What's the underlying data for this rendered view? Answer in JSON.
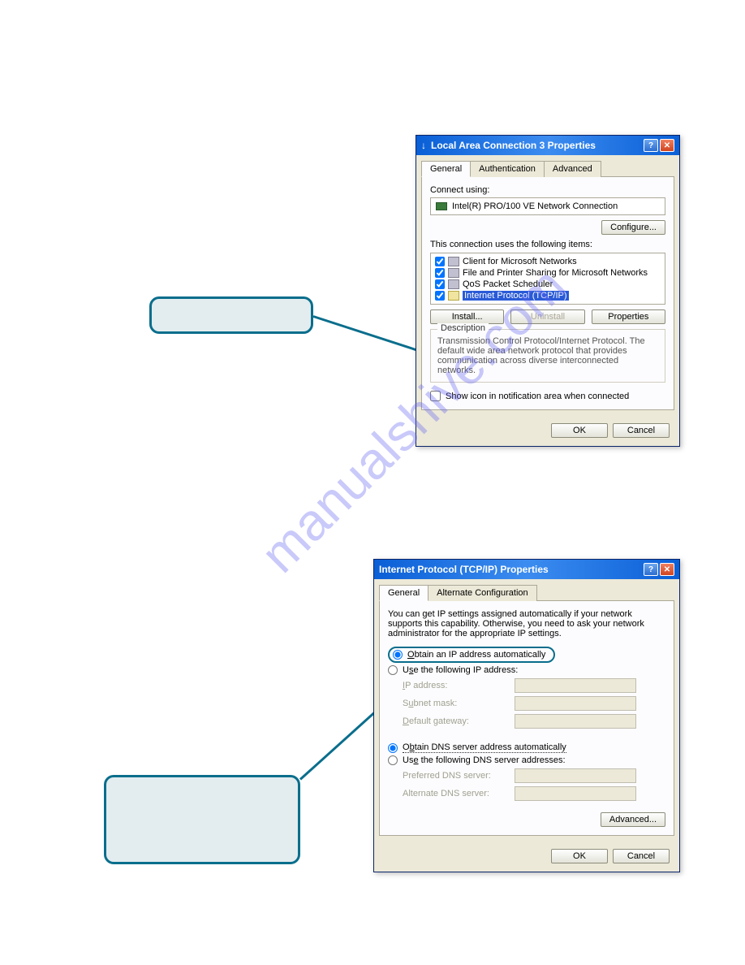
{
  "watermark": "manualshive.com",
  "dialog1": {
    "title": "Local Area Connection 3 Properties",
    "tabs": {
      "general": "General",
      "auth": "Authentication",
      "advanced": "Advanced"
    },
    "connect_using_label": "Connect using:",
    "adapter_name": "Intel(R) PRO/100 VE Network Connection",
    "configure_btn": "Configure...",
    "items_label": "This connection uses the following items:",
    "items": [
      "Client for Microsoft Networks",
      "File and Printer Sharing for Microsoft Networks",
      "QoS Packet Scheduler",
      "Internet Protocol (TCP/IP)"
    ],
    "install_btn": "Install...",
    "uninstall_btn": "Uninstall",
    "properties_btn": "Properties",
    "description_legend": "Description",
    "description_text": "Transmission Control Protocol/Internet Protocol. The default wide area network protocol that provides communication across diverse interconnected networks.",
    "notify_checkbox": "Show icon in notification area when connected",
    "ok_btn": "OK",
    "cancel_btn": "Cancel"
  },
  "dialog2": {
    "title": "Internet Protocol (TCP/IP) Properties",
    "tabs": {
      "general": "General",
      "alt": "Alternate Configuration"
    },
    "intro_text": "You can get IP settings assigned automatically if your network supports this capability. Otherwise, you need to ask your network administrator for the appropriate IP settings.",
    "auto_ip": "Obtain an IP address automatically",
    "use_ip": "Use the following IP address:",
    "ip_addr_label": "IP address:",
    "subnet_label": "Subnet mask:",
    "gateway_label": "Default gateway:",
    "auto_dns": "Obtain DNS server address automatically",
    "use_dns": "Use the following DNS server addresses:",
    "pref_dns_label": "Preferred DNS server:",
    "alt_dns_label": "Alternate DNS server:",
    "advanced_btn": "Advanced...",
    "ok_btn": "OK",
    "cancel_btn": "Cancel"
  }
}
